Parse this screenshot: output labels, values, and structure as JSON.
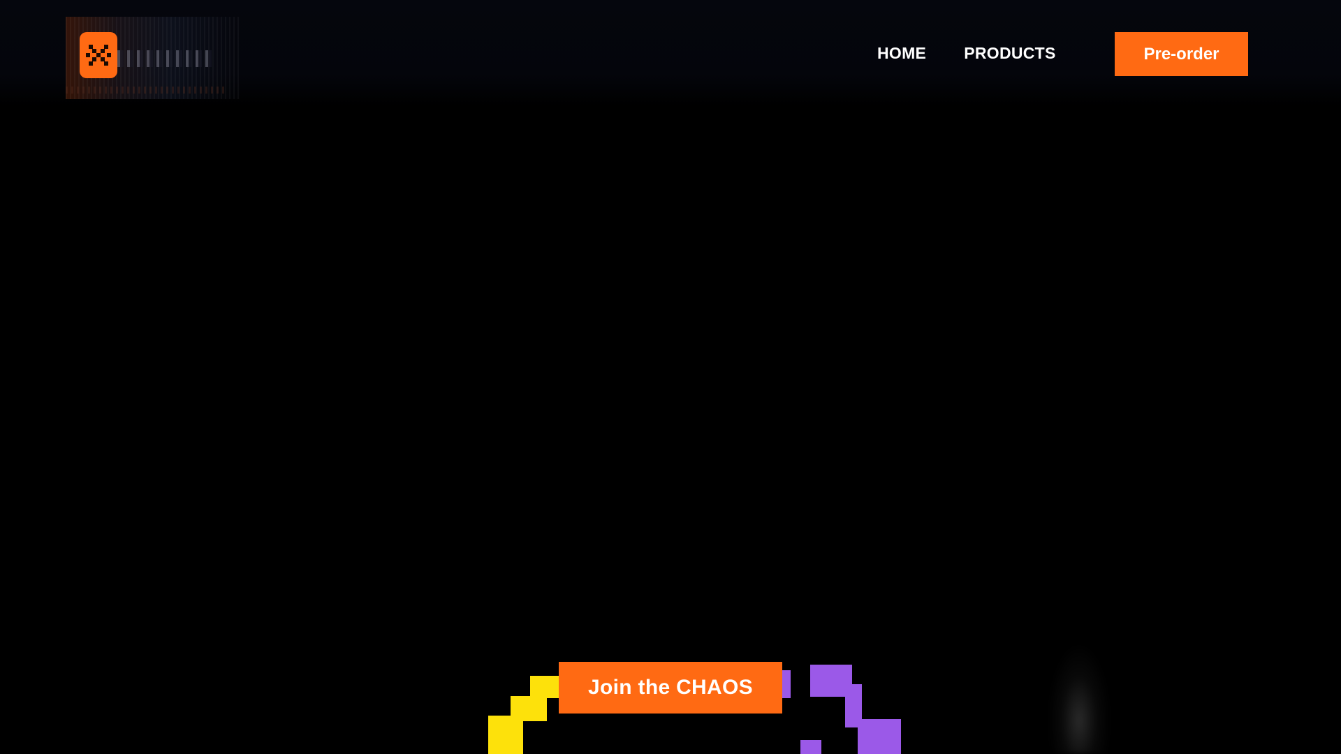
{
  "header": {
    "logo_icon": "x-badge-icon",
    "nav": {
      "items": [
        {
          "label": "HOME"
        },
        {
          "label": "PRODUCTS"
        }
      ]
    },
    "preorder_label": "Pre-order"
  },
  "hero": {
    "cta_label": "Join the CHAOS"
  },
  "colors": {
    "accent": "#ff6a13",
    "background": "#000000",
    "pixel_yellow": "#fde10b",
    "pixel_purple": "#9b59e8"
  }
}
